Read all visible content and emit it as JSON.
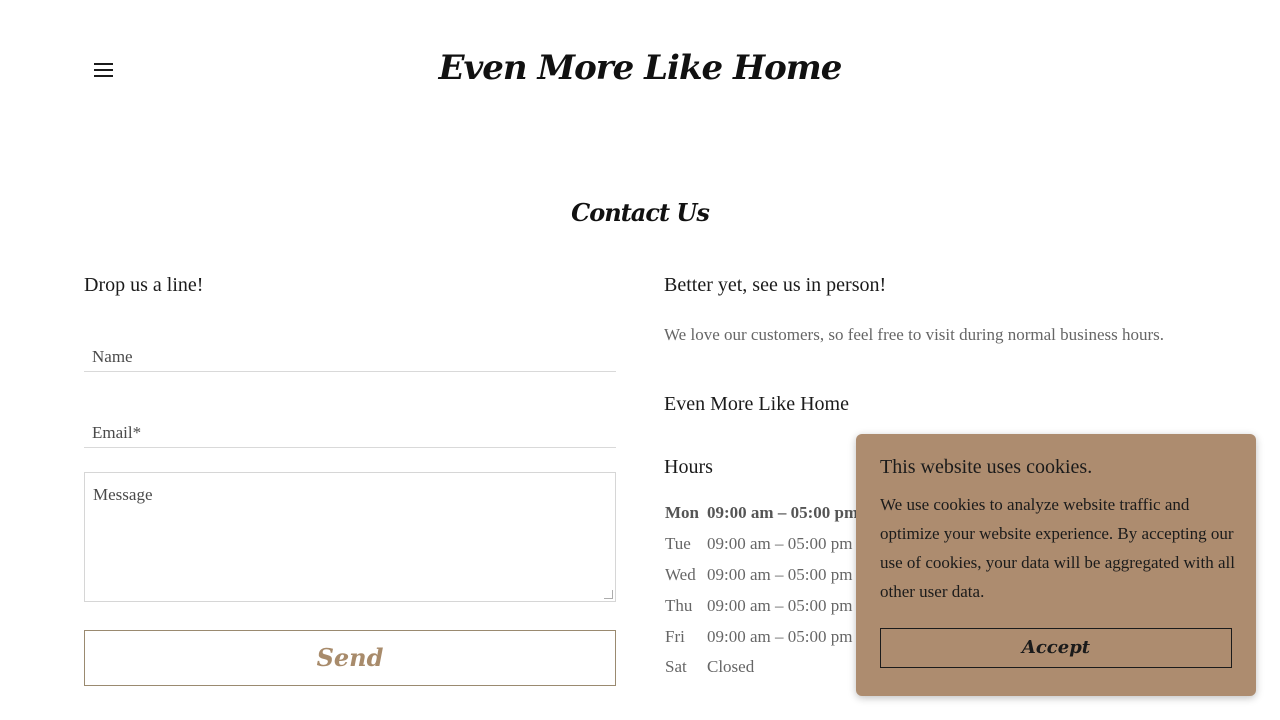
{
  "header": {
    "site_title": "Even More Like Home",
    "menu_icon": "hamburger-menu-icon"
  },
  "contact": {
    "section_title": "Contact Us",
    "form": {
      "heading": "Drop us a line!",
      "name_placeholder": "Name",
      "email_placeholder": "Email*",
      "message_placeholder": "Message",
      "send_label": "Send"
    },
    "info": {
      "heading": "Better yet, see us in person!",
      "intro": "We love our customers, so feel free to visit during normal business hours.",
      "business_name": "Even More Like Home",
      "hours_title": "Hours",
      "hours": [
        {
          "day": "Mon",
          "time": "09:00 am – 05:00 pm",
          "today": true
        },
        {
          "day": "Tue",
          "time": "09:00 am – 05:00 pm"
        },
        {
          "day": "Wed",
          "time": "09:00 am – 05:00 pm"
        },
        {
          "day": "Thu",
          "time": "09:00 am – 05:00 pm"
        },
        {
          "day": "Fri",
          "time": "09:00 am – 05:00 pm"
        },
        {
          "day": "Sat",
          "time": "Closed"
        }
      ]
    }
  },
  "cookie_banner": {
    "title": "This website uses cookies.",
    "text": "We use cookies to analyze website traffic and optimize your website experience. By accepting our use of cookies, your data will be aggregated with all other user data.",
    "accept_label": "Accept"
  },
  "colors": {
    "accent": "#a88b6b",
    "cookie_background": "#ad8c6f",
    "text": "#1b1b1b",
    "muted_text": "#666666"
  }
}
